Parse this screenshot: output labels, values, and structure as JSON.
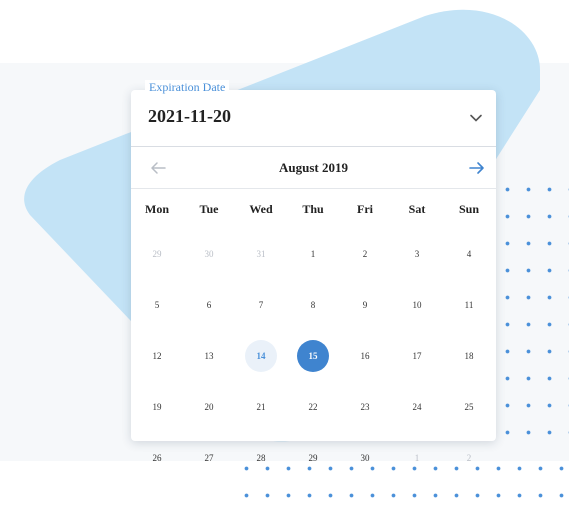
{
  "colors": {
    "accent": "#4a90d9",
    "selected": "#3f84cf",
    "muted": "#b9bec6",
    "blob": "#c3e3f6"
  },
  "field": {
    "label": "Expiration Date",
    "value": "2021-11-20",
    "toggle_icon": "chevron-down-icon"
  },
  "calendar": {
    "month_title": "August 2019",
    "prev_icon": "arrow-left-icon",
    "next_icon": "arrow-right-icon",
    "weekdays": [
      "Mon",
      "Tue",
      "Wed",
      "Thu",
      "Fri",
      "Sat",
      "Sun"
    ],
    "weeks": [
      [
        {
          "d": "29",
          "muted": true
        },
        {
          "d": "30",
          "muted": true
        },
        {
          "d": "31",
          "muted": true
        },
        {
          "d": "1"
        },
        {
          "d": "2"
        },
        {
          "d": "3"
        },
        {
          "d": "4"
        }
      ],
      [
        {
          "d": "5"
        },
        {
          "d": "6"
        },
        {
          "d": "7"
        },
        {
          "d": "8"
        },
        {
          "d": "9"
        },
        {
          "d": "10"
        },
        {
          "d": "11"
        }
      ],
      [
        {
          "d": "12"
        },
        {
          "d": "13"
        },
        {
          "d": "14",
          "today": true
        },
        {
          "d": "15",
          "selected": true
        },
        {
          "d": "16"
        },
        {
          "d": "17"
        },
        {
          "d": "18"
        }
      ],
      [
        {
          "d": "19"
        },
        {
          "d": "20"
        },
        {
          "d": "21"
        },
        {
          "d": "22"
        },
        {
          "d": "23"
        },
        {
          "d": "24"
        },
        {
          "d": "25"
        }
      ],
      [
        {
          "d": "26"
        },
        {
          "d": "27"
        },
        {
          "d": "28"
        },
        {
          "d": "29"
        },
        {
          "d": "30"
        },
        {
          "d": "1",
          "muted": true
        },
        {
          "d": "2",
          "muted": true
        }
      ]
    ]
  }
}
